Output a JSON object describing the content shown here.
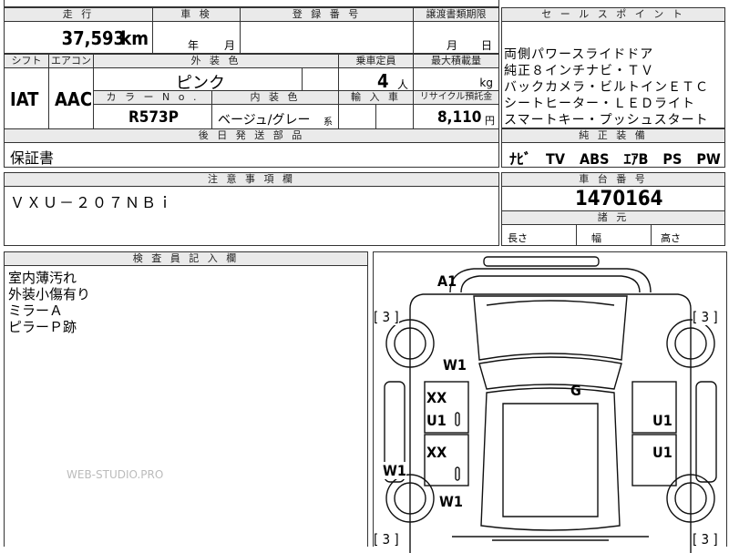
{
  "headers": {
    "mileage": "走 行",
    "inspection": "車 検",
    "registration_no": "登 録 番 号",
    "transfer_deadline": "譲渡書類期限",
    "sales_points": "セ ー ル ス ポ イ ン ト",
    "shift": "シフト",
    "aircon": "エアコン",
    "exterior_color": "外 装 色",
    "capacity": "乗車定員",
    "max_load": "最大積載量",
    "color_no": "カ ラ ー N o .",
    "interior_color": "内 装 色",
    "import": "輸 入 車",
    "recycle_fee": "リサイクル預託金",
    "later_parts": "後 日 発 送 部 品",
    "oem_equipment": "純 正 装 備",
    "notes": "注 意 事 項 欄",
    "chassis_no": "車 台 番 号",
    "dimensions": "諸 元",
    "inspector_notes": "検 査 員 記 入 欄"
  },
  "mileage": {
    "value": "37,593",
    "unit": "km"
  },
  "inspection": {
    "year_label": "年",
    "month_label": "月"
  },
  "transfer_deadline": {
    "month_label": "月",
    "day_label": "日"
  },
  "shift": "IAT",
  "aircon": "AAC",
  "exterior_color": "ピンク",
  "capacity": {
    "value": "4",
    "unit": "人"
  },
  "max_load": {
    "unit": "kg"
  },
  "color_no": "R573P",
  "interior_color": {
    "value": "ベージュ/グレー",
    "suffix": "系"
  },
  "recycle_fee": {
    "value": "8,110",
    "unit": "円"
  },
  "sales_points": [
    "両側パワースライドドア",
    "純正８インチナビ・ＴＶ",
    "バックカメラ・ビルトインＥＴＣ",
    "シートヒーター・ＬＥＤライト",
    "スマートキー・プッシュスタート"
  ],
  "later_parts": "保証書",
  "oem_equipment": "ﾅﾋﾞ　TV　ABS　ｴｱB　PS　PW",
  "notes": "ＶＸＵ－２０７ＮＢｉ",
  "chassis_no": "1470164",
  "dimensions": {
    "length": "長さ",
    "width": "幅",
    "height": "高さ"
  },
  "inspector_notes": [
    "室内薄汚れ",
    "外装小傷有り",
    "ミラーＡ",
    "ピラーＰ跡"
  ],
  "diagram_marks": {
    "top_bumper": "A1",
    "corner_tl": "[ 3 ]",
    "corner_tr": "[ 3 ]",
    "corner_bl": "[ 3 ]",
    "corner_br": "[ 3 ]",
    "fender_left": "W1",
    "glass": "G",
    "front_door_xx": "XX",
    "front_door_u1": "U1",
    "front_door_right_u1": "U1",
    "rear_door_xx": "XX",
    "rear_door_right_u1": "U1",
    "quarter_left": "W1",
    "rear_fender_left": "W1"
  },
  "watermark": "WEB-STUDIO.PRO"
}
